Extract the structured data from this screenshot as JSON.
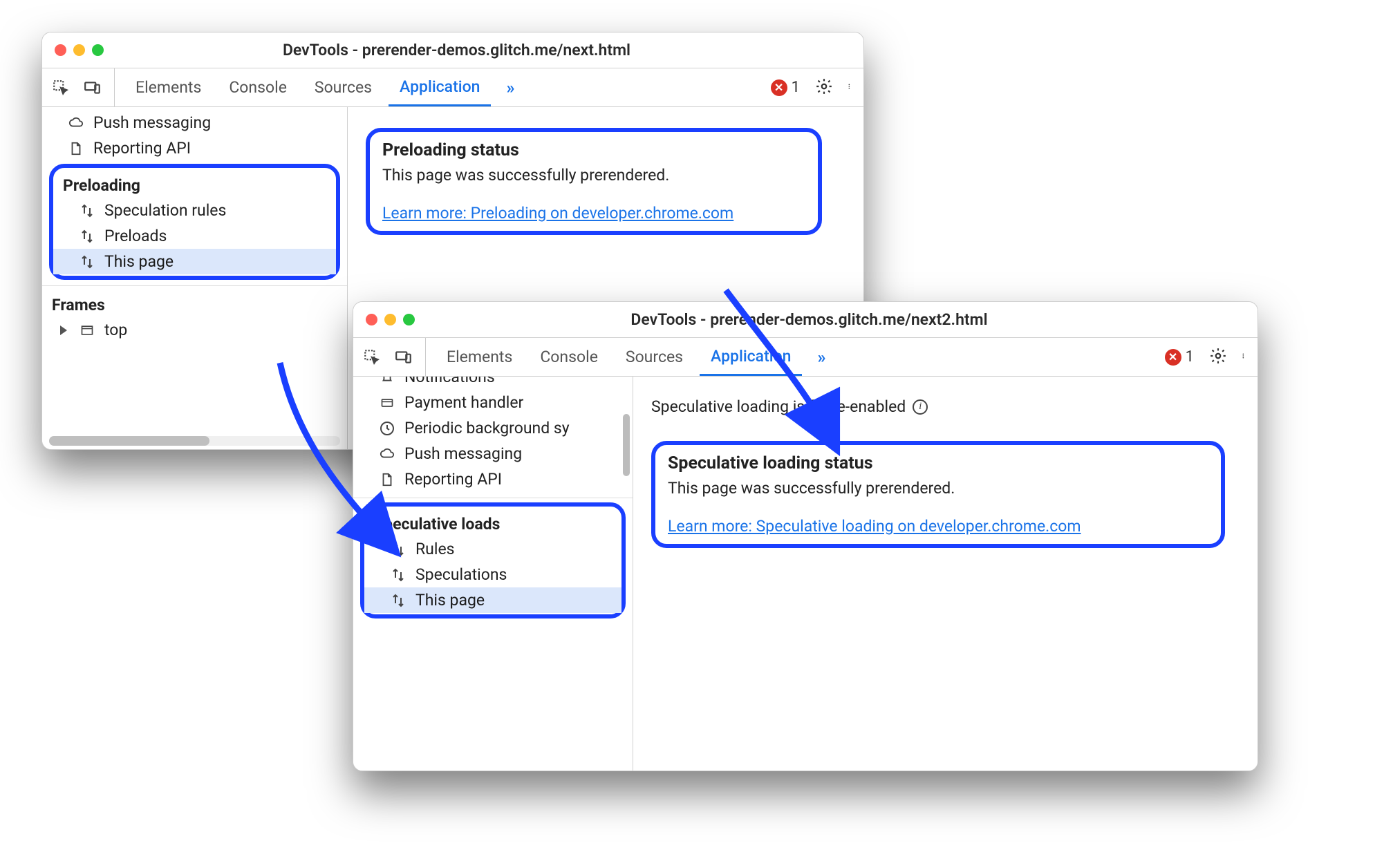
{
  "colors": {
    "highlight": "#1a3fff",
    "link": "#1a73e8",
    "error": "#d93025"
  },
  "windowA": {
    "title": "DevTools - prerender-demos.glitch.me/next.html",
    "tabs": [
      "Elements",
      "Console",
      "Sources",
      "Application"
    ],
    "activeTab": "Application",
    "moreTabs": "»",
    "errorCount": "1",
    "sidebar_top": [
      {
        "label": "Push messaging",
        "icon": "cloud"
      },
      {
        "label": "Reporting API",
        "icon": "doc"
      }
    ],
    "preloading": {
      "group": "Preloading",
      "items": [
        {
          "label": "Speculation rules",
          "icon": "updown",
          "selected": false
        },
        {
          "label": "Preloads",
          "icon": "updown",
          "selected": false
        },
        {
          "label": "This page",
          "icon": "updown",
          "selected": true
        }
      ]
    },
    "frames": {
      "group": "Frames",
      "top": "top"
    },
    "main": {
      "title": "Preloading status",
      "text": "This page was successfully prerendered.",
      "link": "Learn more: Preloading on developer.chrome.com"
    }
  },
  "windowB": {
    "title": "DevTools - prerender-demos.glitch.me/next2.html",
    "tabs": [
      "Elements",
      "Console",
      "Sources",
      "Application"
    ],
    "activeTab": "Application",
    "moreTabs": "»",
    "errorCount": "1",
    "sidebar_top": [
      {
        "label": "Notifications",
        "icon": "bell",
        "cut": true
      },
      {
        "label": "Payment handler",
        "icon": "card"
      },
      {
        "label": "Periodic background sy",
        "icon": "clock"
      },
      {
        "label": "Push messaging",
        "icon": "cloud"
      },
      {
        "label": "Reporting API",
        "icon": "doc"
      }
    ],
    "spec": {
      "group": "Speculative loads",
      "items": [
        {
          "label": "Rules",
          "icon": "updown",
          "selected": false
        },
        {
          "label": "Speculations",
          "icon": "updown",
          "selected": false
        },
        {
          "label": "This page",
          "icon": "updown",
          "selected": true
        }
      ]
    },
    "banner": "Speculative loading is force-enabled",
    "main": {
      "title": "Speculative loading status",
      "text": "This page was successfully prerendered.",
      "link": "Learn more: Speculative loading on developer.chrome.com"
    }
  }
}
